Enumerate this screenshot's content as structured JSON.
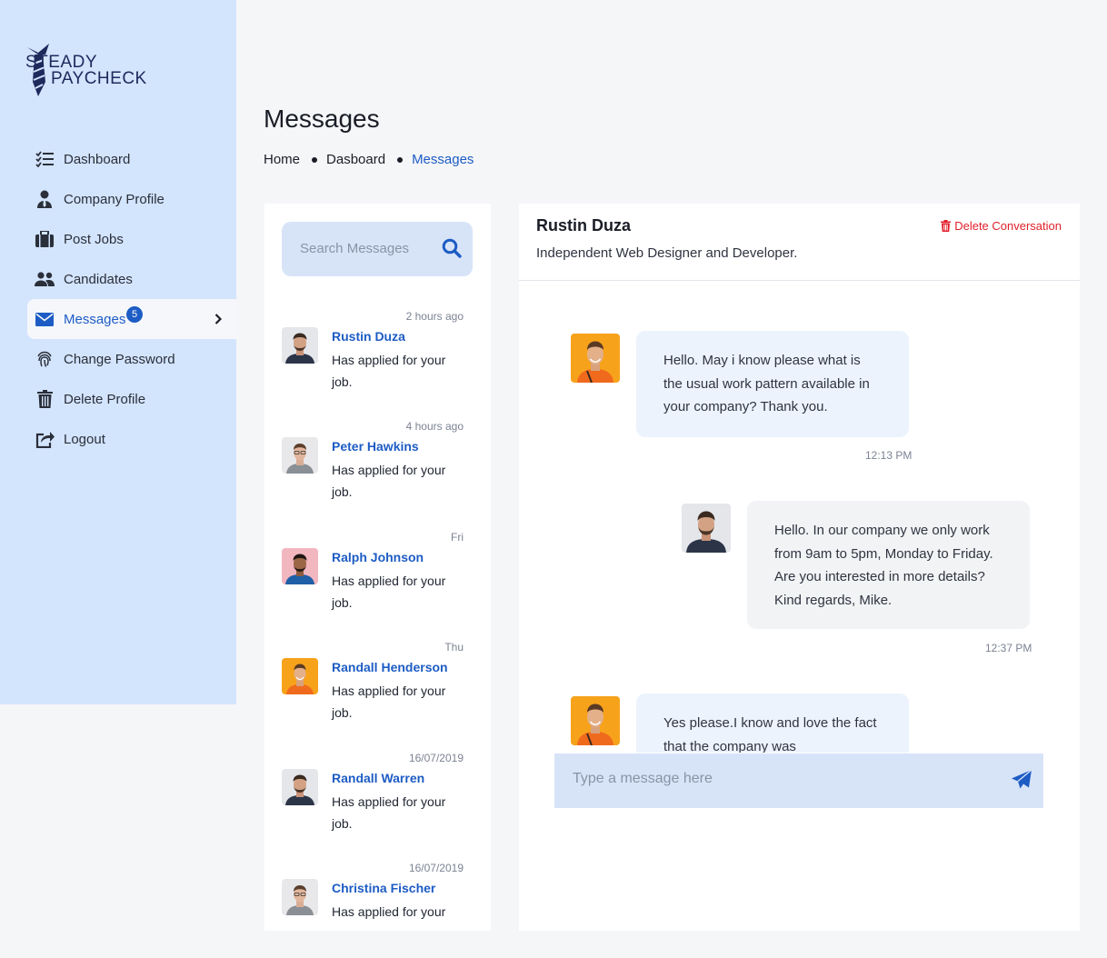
{
  "brand": {
    "line1": "STEADY",
    "line2": "PAYCHECK"
  },
  "nav": [
    {
      "label": "Dashboard",
      "icon": "checklist-icon"
    },
    {
      "label": "Company Profile",
      "icon": "user-tie-icon"
    },
    {
      "label": "Post Jobs",
      "icon": "briefcase-icon"
    },
    {
      "label": "Candidates",
      "icon": "users-icon"
    },
    {
      "label": "Messages",
      "icon": "envelope-icon",
      "badge": "5",
      "active": true
    },
    {
      "label": "Change Password",
      "icon": "fingerprint-icon"
    },
    {
      "label": "Delete Profile",
      "icon": "trash-icon"
    },
    {
      "label": "Logout",
      "icon": "logout-icon"
    }
  ],
  "page": {
    "title": "Messages",
    "breadcrumb": [
      "Home",
      "Dasboard",
      "Messages"
    ]
  },
  "search": {
    "placeholder": "Search Messages"
  },
  "conversations": [
    {
      "time": "2 hours ago",
      "name": "Rustin Duza",
      "preview": "Has applied for your job."
    },
    {
      "time": "4 hours ago",
      "name": "Peter Hawkins",
      "preview": "Has applied for your job."
    },
    {
      "time": "Fri",
      "name": "Ralph Johnson",
      "preview": "Has applied for your job."
    },
    {
      "time": "Thu",
      "name": "Randall Henderson",
      "preview": "Has applied for your job."
    },
    {
      "time": "16/07/2019",
      "name": "Randall Warren",
      "preview": "Has applied for your job."
    },
    {
      "time": "16/07/2019",
      "name": "Christina Fischer",
      "preview": "Has applied for your"
    }
  ],
  "chat": {
    "name": "Rustin Duza",
    "subtitle": "Independent Web Designer and Developer.",
    "delete_label": "Delete Conversation",
    "messages": [
      {
        "text": "Hello. May i know please what is the usual work pattern available in your company? Thank you.",
        "time": "12:13 PM"
      },
      {
        "text": "Hello. In our company we only work from 9am to 5pm, Monday to Friday. Are you interested in more details? Kind regards, Mike.",
        "time": "12:37 PM"
      },
      {
        "text": "Yes please.I know and love the fact that the company was"
      }
    ],
    "compose_placeholder": "Type a message here"
  },
  "colors": {
    "accent": "#1d5cc4",
    "sidebar": "#d3e4fd",
    "danger": "#e0202b"
  }
}
